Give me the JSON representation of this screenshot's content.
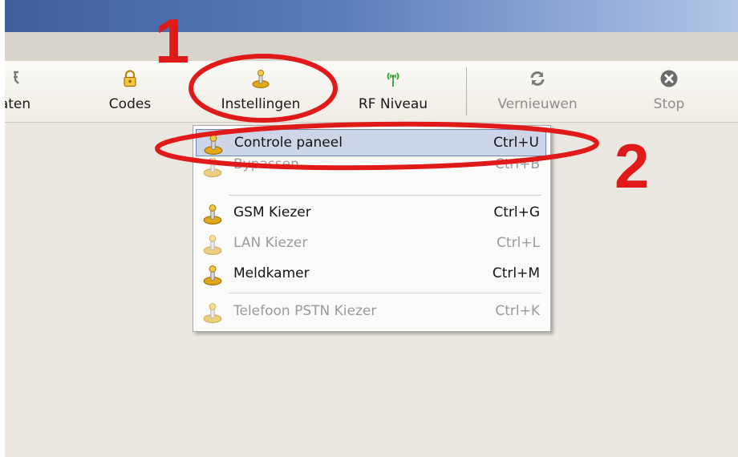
{
  "colors": {
    "accent_red": "#e01919",
    "highlight": "#ccd6e8",
    "disabled": "#9a9a9a"
  },
  "toolbar": {
    "items": [
      {
        "label": "aten",
        "icon": "templates-icon",
        "disabled": false
      },
      {
        "label": "Codes",
        "icon": "lock-icon",
        "disabled": false
      },
      {
        "label": "Instellingen",
        "icon": "joystick-icon",
        "disabled": false
      },
      {
        "label": "RF Niveau",
        "icon": "antenna-icon",
        "disabled": false
      },
      {
        "label": "Vernieuwen",
        "icon": "refresh-icon",
        "disabled": true
      },
      {
        "label": "Stop",
        "icon": "stop-icon",
        "disabled": true
      }
    ]
  },
  "menu": {
    "items": [
      {
        "label": "Controle paneel",
        "shortcut": "Ctrl+U",
        "state": "highlighted"
      },
      {
        "label": "Bypassen",
        "shortcut": "Ctrl+B",
        "state": "disabled"
      },
      {
        "label": "GSM Kiezer",
        "shortcut": "Ctrl+G",
        "state": "enabled"
      },
      {
        "label": "LAN Kiezer",
        "shortcut": "Ctrl+L",
        "state": "disabled"
      },
      {
        "label": "Meldkamer",
        "shortcut": "Ctrl+M",
        "state": "enabled"
      },
      {
        "label": "Telefoon PSTN Kiezer",
        "shortcut": "Ctrl+K",
        "state": "disabled"
      }
    ]
  },
  "annotations": {
    "step1": "1",
    "step2": "2"
  }
}
